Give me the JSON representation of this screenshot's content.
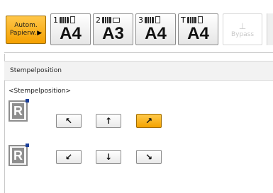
{
  "trays": {
    "auto": {
      "line1": "Autom.",
      "line2": "Papierw."
    },
    "items": [
      {
        "number": "1",
        "size": "A4"
      },
      {
        "number": "2",
        "size": "A3"
      },
      {
        "number": "3",
        "size": "A4"
      },
      {
        "number": "T",
        "size": "A4"
      }
    ],
    "bypass": {
      "label": "Bypass",
      "icon": "bypass-tray-icon"
    }
  },
  "section": {
    "title": "Stempelposition"
  },
  "stamp_position": {
    "group_label": "<Stempelposition>",
    "selected": "top-right",
    "top_row": [
      {
        "id": "top-left",
        "glyph": "↖"
      },
      {
        "id": "top-center",
        "glyph": "↑"
      },
      {
        "id": "top-right",
        "glyph": "↗"
      }
    ],
    "bottom_row": [
      {
        "id": "bottom-left",
        "glyph": "↙"
      },
      {
        "id": "bottom-center",
        "glyph": "↓"
      },
      {
        "id": "bottom-right",
        "glyph": "↘"
      }
    ],
    "preview_letter": "R"
  },
  "colors": {
    "selected": "#f4a300",
    "stamp_mark": "#1b3f9a"
  }
}
